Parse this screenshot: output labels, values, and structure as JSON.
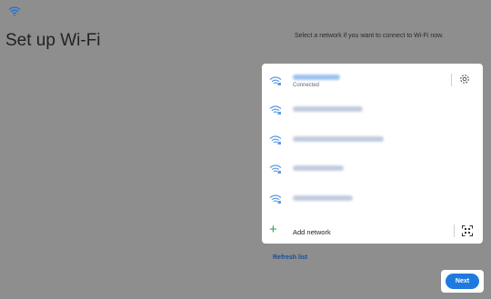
{
  "header": {
    "title": "Set up Wi-Fi",
    "status_icon": "wifi-icon"
  },
  "instruction": "Select a network if you want to connect to Wi-Fi now.",
  "networks": [
    {
      "name": "",
      "status": "Connected",
      "icon": "wifi-lock-icon"
    },
    {
      "name": "",
      "icon": "wifi-lock-icon"
    },
    {
      "name": "",
      "icon": "wifi-lock-icon"
    },
    {
      "name": "",
      "icon": "wifi-lock-icon"
    },
    {
      "name": "",
      "icon": "wifi-lock-icon"
    }
  ],
  "connected_settings_icon": "gear-icon",
  "add_network": {
    "label": "Add network",
    "icon": "plus-icon",
    "qr_icon": "qr-scan-icon"
  },
  "refresh_label": "Refresh list",
  "next_label": "Next",
  "colors": {
    "background": "#8e8e8e",
    "accent": "#1f7ae0",
    "wifi_icon": "#5b9be6",
    "plus": "#2f9e52",
    "link": "#1a4d96"
  }
}
